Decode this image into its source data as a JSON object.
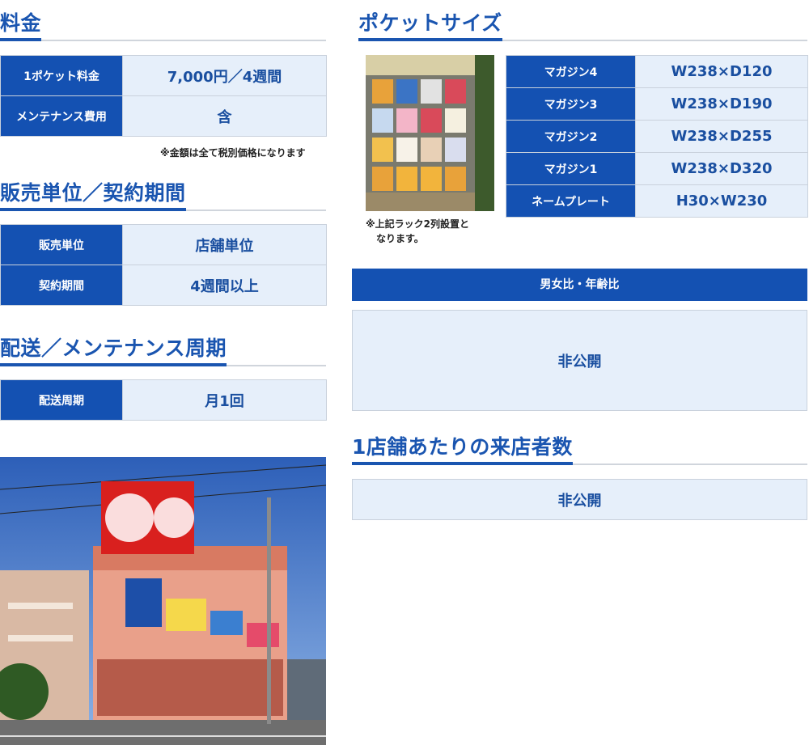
{
  "fee": {
    "heading": "料金",
    "rows": [
      {
        "label": "1ポケット料金",
        "value": "7,000円／4週間"
      },
      {
        "label": "メンテナンス費用",
        "value": "含"
      }
    ],
    "note": "※金額は全て税別価格になります"
  },
  "unit": {
    "heading": "販売単位／契約期間",
    "rows": [
      {
        "label": "販売単位",
        "value": "店舗単位"
      },
      {
        "label": "契約期間",
        "value": "4週間以上"
      }
    ]
  },
  "delivery": {
    "heading": "配送／メンテナンス周期",
    "rows": [
      {
        "label": "配送周期",
        "value": "月1回"
      }
    ]
  },
  "pocket": {
    "heading": "ポケットサイズ",
    "rows": [
      {
        "label": "マガジン4",
        "value": "W238×D120"
      },
      {
        "label": "マガジン3",
        "value": "W238×D190"
      },
      {
        "label": "マガジン2",
        "value": "W238×D255"
      },
      {
        "label": "マガジン1",
        "value": "W238×D320"
      },
      {
        "label": "ネームプレート",
        "value": "H30×W230"
      }
    ],
    "rack_note_line1": "※上記ラック2列設置と",
    "rack_note_line2": "なります。"
  },
  "demographics": {
    "bar_label": "男女比・年齢比",
    "value": "非公開"
  },
  "visitors": {
    "heading": "1店舗あたりの来店者数",
    "value": "非公開"
  },
  "colors": {
    "accent": "#1451b2",
    "cell_bg": "#e6effa",
    "heading": "#1a55b0"
  }
}
